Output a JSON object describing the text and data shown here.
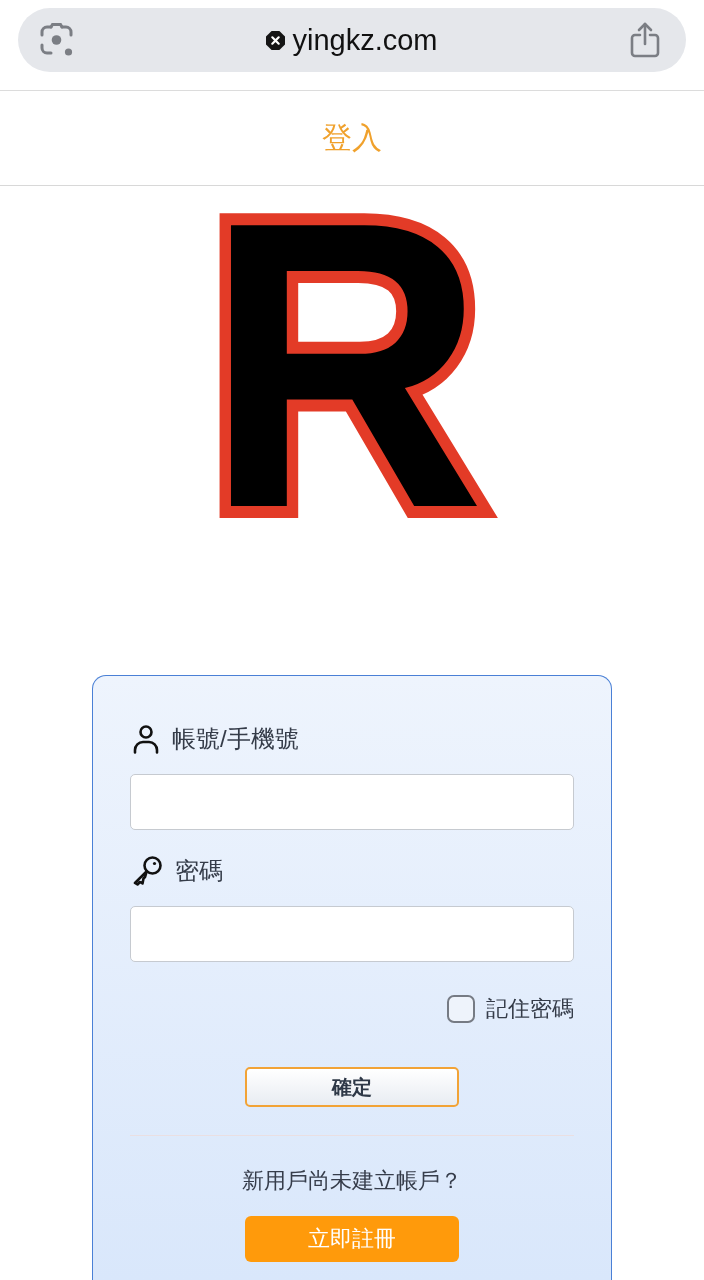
{
  "browser_bar": {
    "url": "yingkz.com"
  },
  "header": {
    "title": "登入"
  },
  "logo": {
    "letter": "R"
  },
  "login_form": {
    "fields": [
      {
        "kind": "account",
        "label": "帳號/手機號"
      },
      {
        "kind": "password",
        "label": "密碼"
      }
    ],
    "remember_password": {
      "label": "記住密碼",
      "checked": false
    },
    "submit_button": {
      "label": "確定"
    },
    "signup_prompt": "新用戶尚未建立帳戶？",
    "signup_button": {
      "label": "立即註冊"
    }
  }
}
